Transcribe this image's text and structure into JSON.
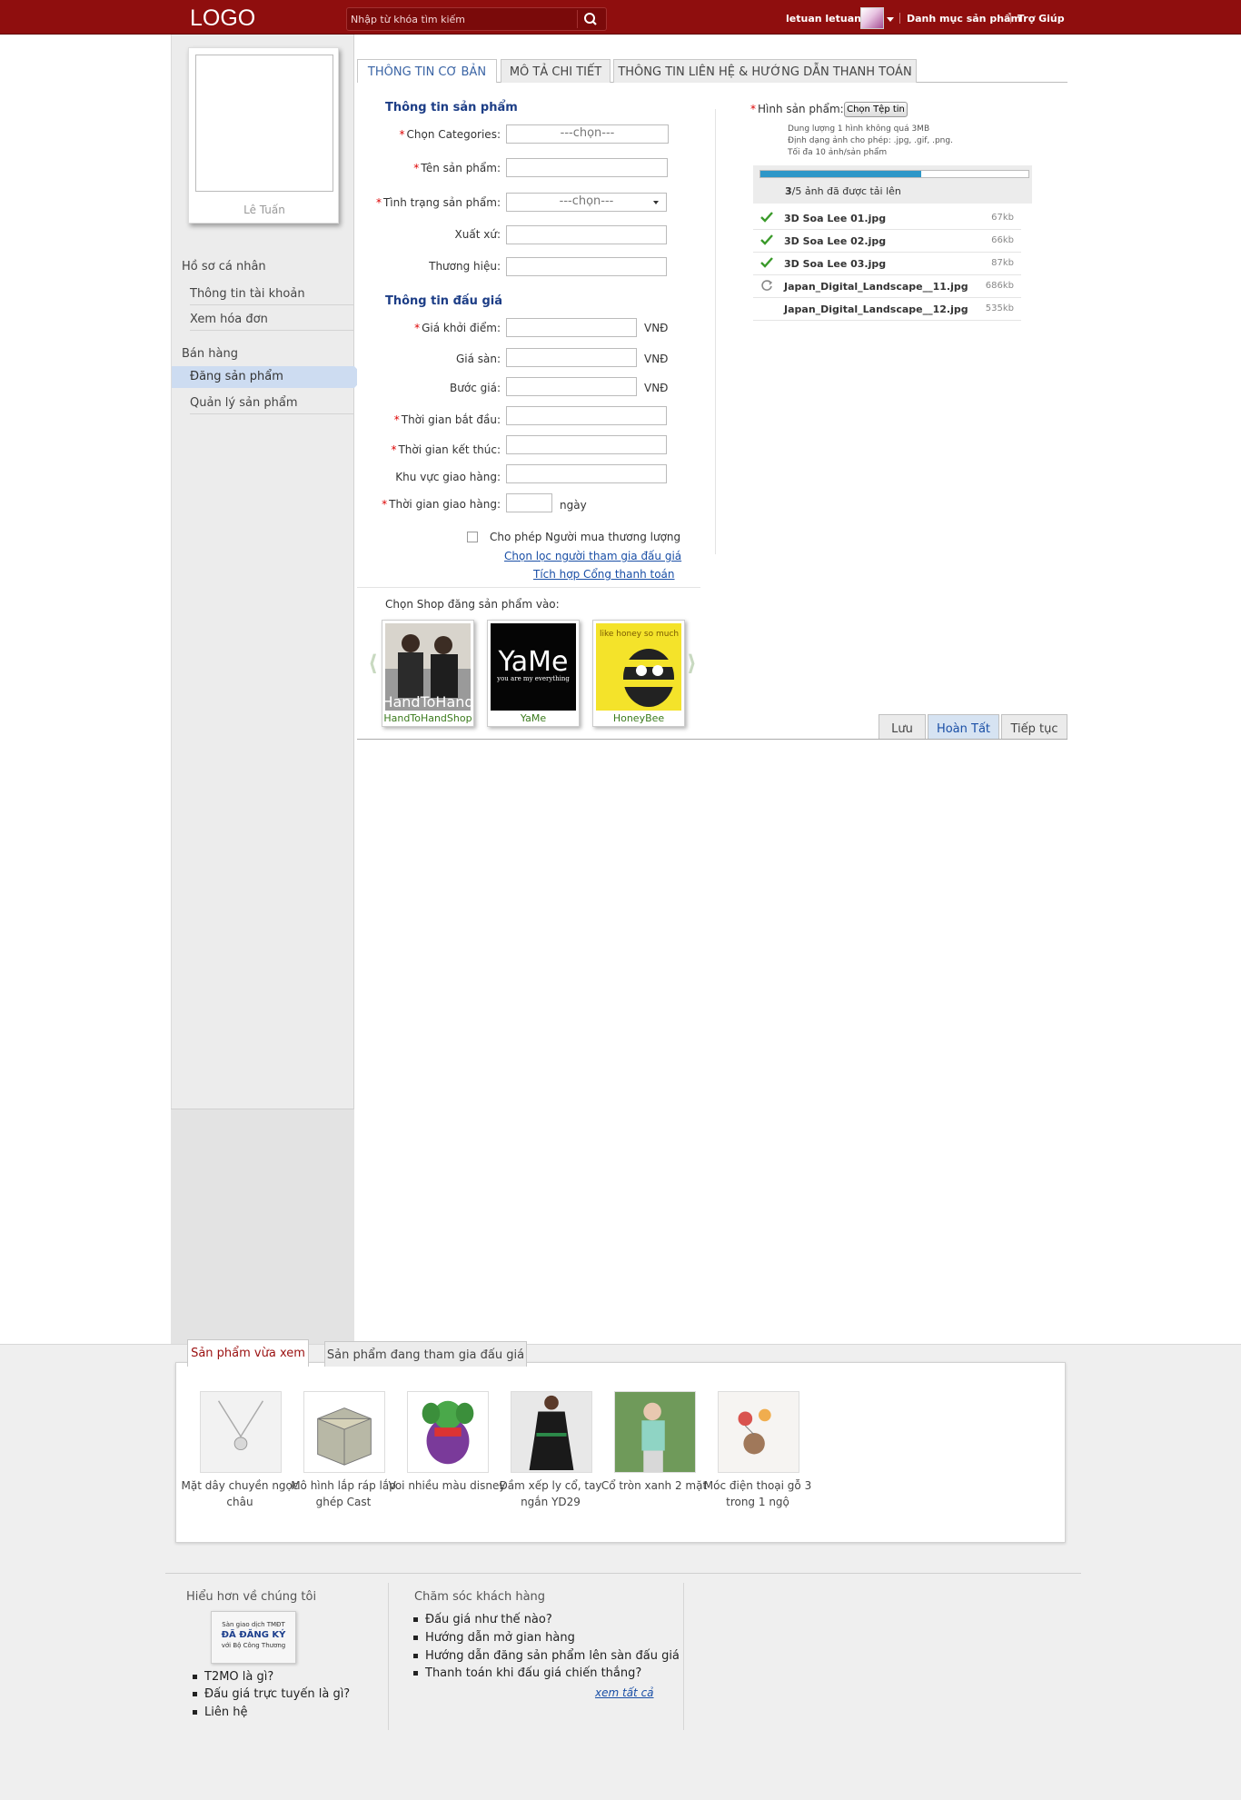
{
  "header": {
    "logo": "LOGO",
    "search_placeholder": "Nhập từ khóa tìm kiếm",
    "user": "letuan letuan...",
    "links": [
      "Danh mục sản phẩm",
      "Trợ Giúp"
    ]
  },
  "sidebar": {
    "profile_name": "Lê Tuấn",
    "group1_title": "Hồ sơ cá nhân",
    "group1_items": [
      "Thông tin tài khoản",
      "Xem hóa đơn"
    ],
    "group2_title": "Bán hàng",
    "group2_items": [
      "Đăng sản phẩm",
      "Quản lý sản phẩm"
    ]
  },
  "tabs": [
    "THÔNG TIN CƠ BẢN",
    "MÔ TẢ CHI TIẾT",
    "THÔNG TIN LIÊN HỆ & HƯỚNG DẪN THANH TOÁN"
  ],
  "form": {
    "product_section": "Thông tin sản phẩm",
    "labels": {
      "category": "Chọn Categories:",
      "name": "Tên sản phẩm:",
      "status": "Tình trạng sản phẩm:",
      "origin": "Xuất xứ:",
      "brand": "Thương hiệu:"
    },
    "select_placeholder": "---chọn---",
    "auction_section": "Thông tin đấu giá",
    "auction_labels": {
      "start_price": "Giá khởi điểm:",
      "floor_price": "Giá sàn:",
      "step": "Bước giá:",
      "start_time": "Thời gian bắt đầu:",
      "end_time": "Thời gian kết thúc:",
      "area": "Khu vực giao hàng:",
      "delivery": "Thời gian giao hàng:"
    },
    "currency": "VNĐ",
    "days": "ngày",
    "negotiate": "Cho phép Người mua thương lượng",
    "link_filter": "Chọn lọc người tham gia đấu giá",
    "link_payment": "Tích hợp Cổng thanh toán",
    "shop_title": "Chọn Shop  đăng sản phẩm vào:",
    "shops": [
      "HandToHandShop",
      "YaMe",
      "HoneyBee"
    ],
    "shop_logo_text": {
      "handtohand": "HandToHand",
      "yame": "YaMe",
      "yame_sub": "you are my everything",
      "honeybee": "like honey so much"
    }
  },
  "upload": {
    "label": "Hình sản phẩm:",
    "button": "Chọn Tệp tin",
    "notes": [
      "Dung lượng 1 hình không quá 3MB",
      "Định dạng ảnh cho phép: .jpg, .gif, .png.",
      "Tối đa 10 ảnh/sản phẩm"
    ],
    "count_bold": "3",
    "count_text": "/5 ảnh đã được tải lên",
    "progress": 0.6,
    "files": [
      {
        "name": "3D Soa Lee 01.jpg",
        "size": "67kb",
        "status": "done"
      },
      {
        "name": "3D Soa Lee 02.jpg",
        "size": "66kb",
        "status": "done"
      },
      {
        "name": "3D Soa Lee 03.jpg",
        "size": "87kb",
        "status": "done"
      },
      {
        "name": "Japan_Digital_Landscape__11.jpg",
        "size": "686kb",
        "status": "uploading"
      },
      {
        "name": "Japan_Digital_Landscape__12.jpg",
        "size": "535kb",
        "status": "queued"
      }
    ]
  },
  "actions": {
    "save": "Lưu",
    "finish": "Hoàn Tất",
    "continue": "Tiếp tục"
  },
  "recent": {
    "tabs": [
      "Sản phẩm vừa xem",
      "Sản phẩm đang tham gia đấu giá"
    ],
    "products": [
      "Mặt dây chuyền ngọc châu",
      "Mô hình lắp ráp lắp ghép Cast",
      "Voi nhiều màu disney",
      "Đầm xếp ly cổ, tay ngắn YD29",
      "Cổ tròn xanh 2 mặt",
      "Móc điện thoại gỗ 3 trong 1 ngộ"
    ]
  },
  "footer": {
    "about_title": "Hiểu hơn về chúng tôi",
    "badge": {
      "line1": "Sàn giao dịch TMĐT",
      "line2": "ĐÃ ĐĂNG KÝ",
      "line3": "với Bộ Công Thương"
    },
    "about_links": [
      "T2MO là gì?",
      "Đấu giá trực tuyến là gì?",
      "Liên hệ"
    ],
    "care_title": "Chăm sóc khách hàng",
    "care_links": [
      "Đấu giá như thế nào?",
      "Hướng dẫn mở gian hàng",
      "Hướng dẫn đăng sản phẩm lên sàn đấu giá",
      "Thanh toán khi đấu giá chiến thắng?"
    ],
    "see_all": "xem tất cả"
  },
  "colors": {
    "header": "#8f0e0e",
    "accent_blue": "#1c3d86",
    "progress": "#2d97c8",
    "check": "#3a9a2a"
  }
}
